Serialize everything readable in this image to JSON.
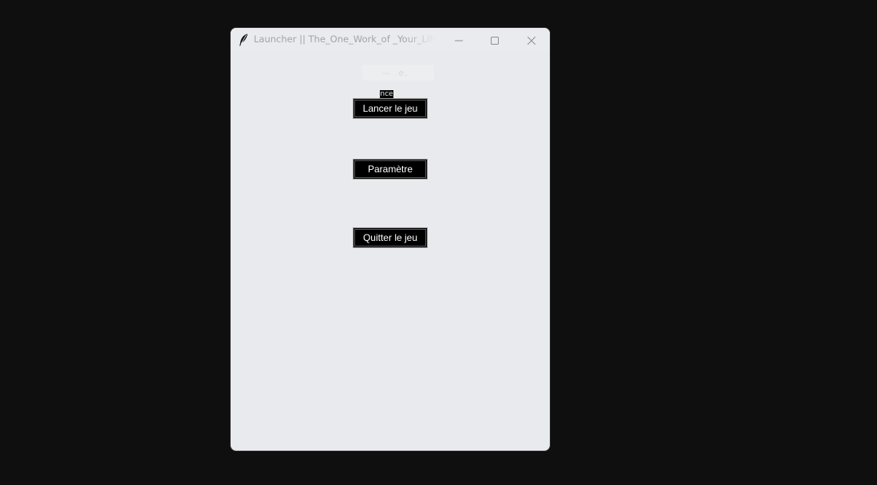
{
  "window": {
    "title": "Launcher || The_One_Work_of _Your_Life — v",
    "controls": {
      "minimize_icon": "minimize-icon",
      "maximize_icon": "maximize-icon",
      "close_icon": "close-icon"
    },
    "app_icon": "feather-icon"
  },
  "main": {
    "ghost_title": "— .e.",
    "mini_chip": "nce",
    "buttons": {
      "play_label": "Lancer le jeu",
      "settings_label": "Paramètre",
      "quit_label": "Quitter le jeu"
    }
  },
  "colors": {
    "desktop_bg": "#0f0f10",
    "window_bg": "#e9eaed",
    "button_bg": "#000000",
    "button_text": "#ffffff"
  }
}
